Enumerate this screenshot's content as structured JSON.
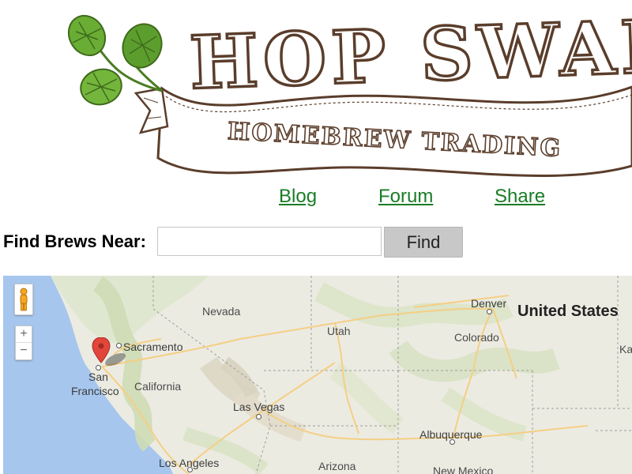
{
  "logo": {
    "title": "HOP SWAP",
    "subtitle": "HOMEBREW TRADING"
  },
  "nav": {
    "blog": "Blog",
    "forum": "Forum",
    "share": "Share"
  },
  "search": {
    "label": "Find Brews Near:",
    "value": "",
    "placeholder": "",
    "button_label": "Find"
  },
  "map": {
    "zoom_in": "+",
    "zoom_out": "−",
    "pegman_icon": "street-view-pegman-icon",
    "marker_icon": "map-marker-icon",
    "countries": {
      "united_states": "United States"
    },
    "states": {
      "nevada": "Nevada",
      "utah": "Utah",
      "colorado": "Colorado",
      "california": "California",
      "arizona": "Arizona",
      "kansas_partial": "Ka"
    },
    "cities": {
      "denver": "Denver",
      "sacramento": "Sacramento",
      "san_francisco_line1": "San",
      "san_francisco_line2": "Francisco",
      "las_vegas": "Las Vegas",
      "albuquerque": "Albuquerque",
      "los_angeles": "Los Angeles",
      "new_mexico": "New Mexico"
    }
  },
  "colors": {
    "nav_link": "#1a7d26",
    "logo_ink": "#5a3d2b",
    "hops_green": "#5c9e2e",
    "find_button_bg": "#c8c8c8",
    "marker_red": "#e2463b",
    "ocean": "#a6c6ee",
    "land": "#ecebe2"
  }
}
